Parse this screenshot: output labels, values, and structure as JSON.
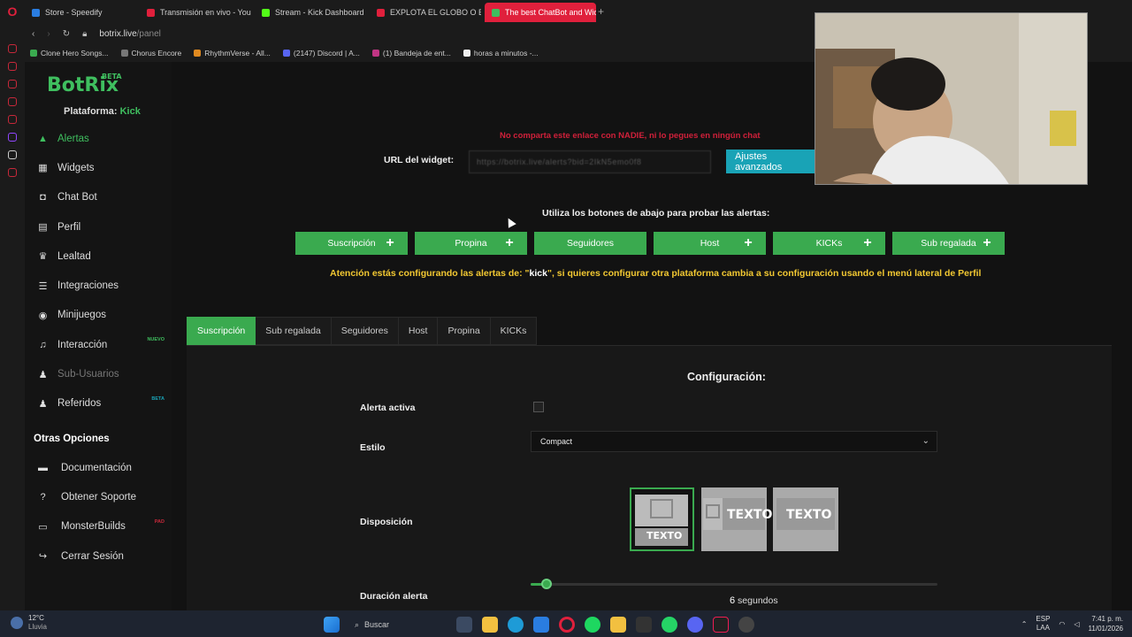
{
  "browser": {
    "tabs": [
      {
        "label": "Store - Speedify",
        "color": "#2a7de1"
      },
      {
        "label": "Transmisión en vivo - You",
        "color": "#e0203c"
      },
      {
        "label": "Stream - Kick Dashboard",
        "color": "#53fc18"
      },
      {
        "label": "EXPLOTA EL GLOBO O EN",
        "color": "#e0203c"
      },
      {
        "label": "The best ChatBot and Wid",
        "color": "#3fbf5f"
      }
    ],
    "active_tab_index": 4,
    "new_tab": "+",
    "url_host": "botrix.live",
    "url_path": "/panel",
    "bookmarks": [
      {
        "label": "Clone Hero Songs...",
        "color": "#3aaa4f"
      },
      {
        "label": "Chorus Encore",
        "color": "#777"
      },
      {
        "label": "RhythmVerse - All...",
        "color": "#e08a20"
      },
      {
        "label": "(2147) Discord | A...",
        "color": "#5865f2"
      },
      {
        "label": "(1) Bandeja de ent...",
        "color": "#c13584"
      },
      {
        "label": "horas a minutos -...",
        "color": "#eee"
      }
    ]
  },
  "sidebar": {
    "logo": "BotRix",
    "logo_badge": "BETA",
    "platform_label": "Plataforma:",
    "platform_value": "Kick",
    "items": [
      {
        "label": "Alertas",
        "icon": "warning-icon",
        "glyph": "▲",
        "state": "active"
      },
      {
        "label": "Widgets",
        "icon": "grid-icon",
        "glyph": "▦",
        "state": ""
      },
      {
        "label": "Chat Bot",
        "icon": "robot-icon",
        "glyph": "◘",
        "state": ""
      },
      {
        "label": "Perfil",
        "icon": "id-card-icon",
        "glyph": "▤",
        "state": ""
      },
      {
        "label": "Lealtad",
        "icon": "trophy-icon",
        "glyph": "♛",
        "state": ""
      },
      {
        "label": "Integraciones",
        "icon": "list-icon",
        "glyph": "☰",
        "state": ""
      },
      {
        "label": "Minijuegos",
        "icon": "gamepad-icon",
        "glyph": "◉",
        "state": ""
      },
      {
        "label": "Interacción",
        "icon": "music-icon",
        "glyph": "♫",
        "state": "",
        "badge": "NUEVO",
        "badge_color": "#3fbf5f"
      },
      {
        "label": "Sub-Usuarios",
        "icon": "users-icon",
        "glyph": "♟",
        "state": "muted"
      },
      {
        "label": "Referidos",
        "icon": "user-group-icon",
        "glyph": "♟",
        "state": "",
        "badge": "BETA",
        "badge_color": "#19a3b6"
      }
    ],
    "other_title": "Otras Opciones",
    "other_items": [
      {
        "label": "Documentación",
        "icon": "book-icon",
        "glyph": "▬"
      },
      {
        "label": "Obtener Soporte",
        "icon": "help-icon",
        "glyph": "?"
      },
      {
        "label": "MonsterBuilds",
        "icon": "laptop-icon",
        "glyph": "▭",
        "badge": "PAD",
        "badge_color": "#c8283a"
      },
      {
        "label": "Cerrar Sesión",
        "icon": "logout-icon",
        "glyph": "↪"
      }
    ]
  },
  "main": {
    "warning_red": "No comparta este enlace con NADIE, ni lo pegues en ningún chat",
    "widget_url_label": "URL del widget:",
    "widget_url_value": "https://botrix.live/alerts?bid=2IkN5emo0f8",
    "advanced_button": "Ajustes avanzados",
    "test_title": "Utiliza los botones de abajo para probar las alertas:",
    "test_buttons": [
      {
        "label": "Suscripción",
        "plus": true
      },
      {
        "label": "Propina",
        "plus": true
      },
      {
        "label": "Seguidores",
        "plus": false
      },
      {
        "label": "Host",
        "plus": true
      },
      {
        "label": "KICKs",
        "plus": true
      },
      {
        "label": "Sub regalada",
        "plus": true
      }
    ],
    "warning_yellow_pre": "Atención estás configurando las alertas de: \"",
    "warning_yellow_platform": "kick",
    "warning_yellow_post": "\", si quieres configurar otra plataforma cambia a su configuración usando el menú lateral de Perfil",
    "config_tabs": [
      "Suscripción",
      "Sub regalada",
      "Seguidores",
      "Host",
      "Propina",
      "KICKs"
    ],
    "active_config_tab": 0,
    "config_title": "Configuración:",
    "fields": {
      "active_label": "Alerta activa",
      "active_checked": false,
      "style_label": "Estilo",
      "style_value": "Compact",
      "layout_label": "Disposición",
      "layout_text": "TEXTO",
      "layout_selected": 0,
      "duration_label": "Duración alerta",
      "duration_value": "6",
      "duration_unit": "segundos",
      "duration_fraction": 0.04
    }
  },
  "taskbar": {
    "temperature": "12°C",
    "weather": "Lluvia",
    "search_placeholder": "Buscar",
    "lang": "ESP",
    "lang2": "LAA",
    "time": "7:41 p. m.",
    "date": "11/01/2026"
  },
  "colors": {
    "accent_green": "#3aaa4f",
    "accent_teal": "#19a3b6",
    "warning_red": "#d0203a",
    "warning_yellow": "#f2c832"
  }
}
